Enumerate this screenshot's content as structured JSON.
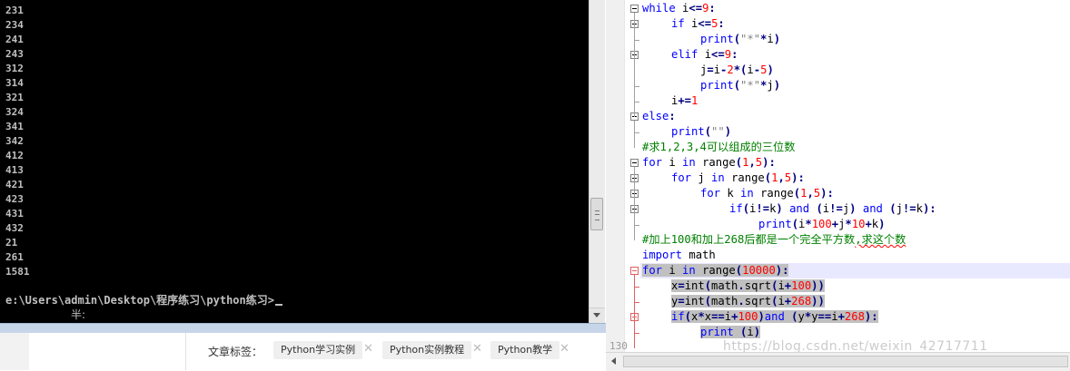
{
  "terminal": {
    "output_lines": [
      "231",
      "234",
      "241",
      "243",
      "312",
      "314",
      "321",
      "324",
      "341",
      "342",
      "412",
      "413",
      "421",
      "423",
      "431",
      "432",
      "21",
      "261",
      "1581"
    ],
    "prompt": "e:\\Users\\admin\\Desktop\\程序练习\\python练习>",
    "ime_indicator": "半:"
  },
  "blog": {
    "tags_label": "文章标签：",
    "tags": [
      "Python学习实例",
      "Python实例教程",
      "Python教学"
    ]
  },
  "editor": {
    "line_130": "130",
    "watermark": "https://blog.csdn.net/weixin_42717711",
    "code_lines": [
      {
        "indent": 0,
        "text": "while i<=9:"
      },
      {
        "indent": 1,
        "text": "if i<=5:"
      },
      {
        "indent": 2,
        "text": "print(\"*\"*i)"
      },
      {
        "indent": 1,
        "text": "elif i<=9:"
      },
      {
        "indent": 2,
        "text": "j=i-2*(i-5)"
      },
      {
        "indent": 2,
        "text": "print(\"*\"*j)"
      },
      {
        "indent": 1,
        "text": "i+=1"
      },
      {
        "indent": 0,
        "text": "else:"
      },
      {
        "indent": 1,
        "text": "print(\"\")"
      },
      {
        "indent": 0,
        "text": "#求1,2,3,4可以组成的三位数"
      },
      {
        "indent": 0,
        "text": "for i in range(1,5):"
      },
      {
        "indent": 1,
        "text": "for j in range(1,5):"
      },
      {
        "indent": 2,
        "text": "for k in range(1,5):"
      },
      {
        "indent": 3,
        "text": "if(i!=k) and (i!=j) and (j!=k):"
      },
      {
        "indent": 4,
        "text": "print(i*100+j*10+k)"
      },
      {
        "indent": 0,
        "text": "#加上100和加上268后都是一个完全平方数,求这个数"
      },
      {
        "indent": 0,
        "text": "import math"
      },
      {
        "indent": 0,
        "text": "for i in range(10000):"
      },
      {
        "indent": 1,
        "text": "x=int(math.sqrt(i+100))"
      },
      {
        "indent": 1,
        "text": "y=int(math.sqrt(i+268))"
      },
      {
        "indent": 1,
        "text": "if(x*x==i+100)and (y*y==i+268):"
      },
      {
        "indent": 2,
        "text": "print (i)"
      }
    ]
  }
}
